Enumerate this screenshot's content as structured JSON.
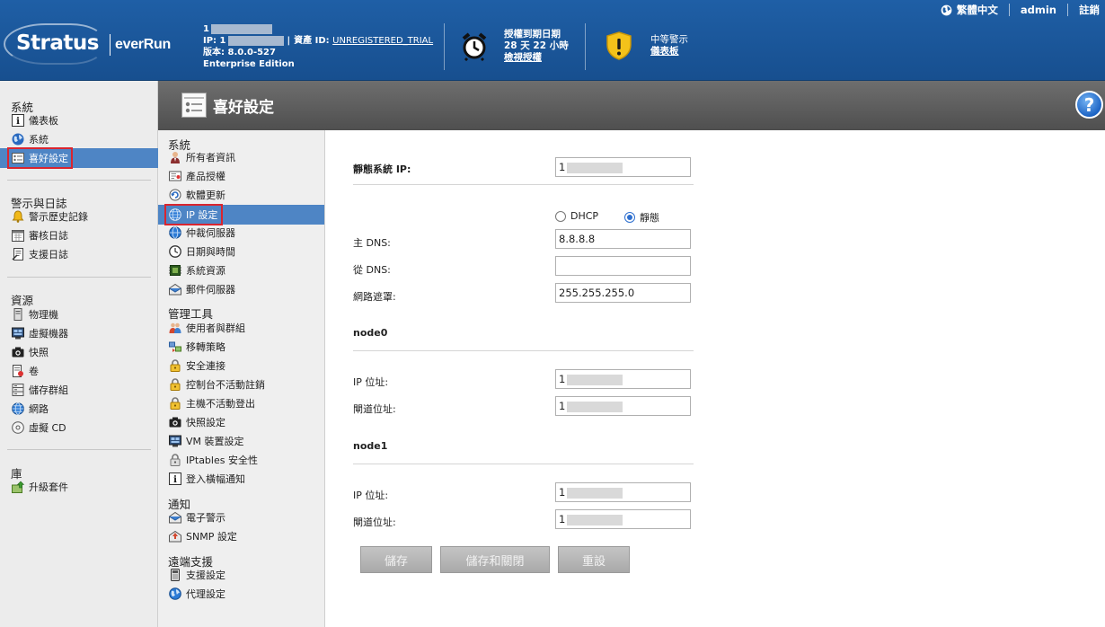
{
  "header": {
    "brand_main": "Stratus",
    "brand_sub": "everRun",
    "system_name_prefix": "1",
    "ip_label": "IP: 1",
    "asset_label": "資產 ID:",
    "asset_value": "UNREGISTERED_TRIAL",
    "version_label": "版本: 8.0.0-527",
    "edition": "Enterprise Edition",
    "license_title": "授權到期日期",
    "license_remaining": "28 天 22 小時",
    "license_link": "檢視授權",
    "alert_title": "中等警示",
    "alert_link": "儀表板",
    "language": "繁體中文",
    "user": "admin",
    "logout": "註銷"
  },
  "left_nav": {
    "sections": [
      {
        "title": "系統",
        "items": [
          {
            "label": "儀表板",
            "icon": "info-icon"
          },
          {
            "label": "系統",
            "icon": "globe-icon"
          },
          {
            "label": "喜好設定",
            "icon": "preferences-icon",
            "active": true
          }
        ]
      },
      {
        "title": "警示與日誌",
        "items": [
          {
            "label": "警示歷史記錄",
            "icon": "bell-icon"
          },
          {
            "label": "審核日誌",
            "icon": "calendar-icon"
          },
          {
            "label": "支援日誌",
            "icon": "log-icon"
          }
        ]
      },
      {
        "title": "資源",
        "items": [
          {
            "label": "物理機",
            "icon": "server-icon"
          },
          {
            "label": "虛擬機器",
            "icon": "vm-icon"
          },
          {
            "label": "快照",
            "icon": "camera-icon"
          },
          {
            "label": "卷",
            "icon": "volume-icon"
          },
          {
            "label": "儲存群組",
            "icon": "storage-icon"
          },
          {
            "label": "網路",
            "icon": "network-icon"
          },
          {
            "label": "虛擬 CD",
            "icon": "cd-icon"
          }
        ]
      },
      {
        "title": "庫",
        "items": [
          {
            "label": "升級套件",
            "icon": "upgrade-icon"
          }
        ]
      }
    ]
  },
  "page": {
    "title": "喜好設定",
    "help": "?"
  },
  "sub_nav": {
    "sections": [
      {
        "title": "系統",
        "items": [
          {
            "label": "所有者資訊",
            "icon": "owner-icon"
          },
          {
            "label": "產品授權",
            "icon": "license-icon"
          },
          {
            "label": "軟體更新",
            "icon": "update-icon"
          },
          {
            "label": "IP 設定",
            "icon": "ip-icon",
            "active": true
          },
          {
            "label": "仲裁伺服器",
            "icon": "quorum-icon"
          },
          {
            "label": "日期與時間",
            "icon": "clock-icon"
          },
          {
            "label": "系統資源",
            "icon": "chip-icon"
          },
          {
            "label": "郵件伺服器",
            "icon": "mail-server-icon"
          }
        ]
      },
      {
        "title": "管理工具",
        "items": [
          {
            "label": "使用者與群組",
            "icon": "users-icon"
          },
          {
            "label": "移轉策略",
            "icon": "migrate-icon"
          },
          {
            "label": "安全連接",
            "icon": "lock-icon"
          },
          {
            "label": "控制台不活動註銷",
            "icon": "lock-icon"
          },
          {
            "label": "主機不活動登出",
            "icon": "lock-icon"
          },
          {
            "label": "快照設定",
            "icon": "camera-icon"
          },
          {
            "label": "VM 裝置設定",
            "icon": "vm-device-icon"
          },
          {
            "label": "IPtables 安全性",
            "icon": "lock-icon"
          },
          {
            "label": "登入橫幅通知",
            "icon": "info-icon"
          }
        ]
      },
      {
        "title": "通知",
        "items": [
          {
            "label": "電子警示",
            "icon": "email-icon"
          },
          {
            "label": "SNMP 設定",
            "icon": "snmp-icon"
          }
        ]
      },
      {
        "title": "遠端支援",
        "items": [
          {
            "label": "支援設定",
            "icon": "phone-icon"
          },
          {
            "label": "代理設定",
            "icon": "proxy-icon"
          }
        ]
      }
    ]
  },
  "form": {
    "static_ip_label": "靜態系統 IP:",
    "static_ip_value": "1",
    "dhcp_label": "DHCP",
    "static_label": "靜態",
    "mode": "static",
    "primary_dns_label": "主 DNS:",
    "primary_dns_value": "8.8.8.8",
    "secondary_dns_label": "從 DNS:",
    "secondary_dns_value": "",
    "netmask_label": "網路遮罩:",
    "netmask_value": "255.255.255.0",
    "node0": {
      "title": "node0",
      "ip_label": "IP 位址:",
      "ip_value": "1",
      "gateway_label": "閘道位址:",
      "gateway_value": "1"
    },
    "node1": {
      "title": "node1",
      "ip_label": "IP 位址:",
      "ip_value": "1",
      "gateway_label": "閘道位址:",
      "gateway_value": "1"
    },
    "buttons": {
      "save": "儲存",
      "save_close": "儲存和關閉",
      "reset": "重設"
    }
  }
}
